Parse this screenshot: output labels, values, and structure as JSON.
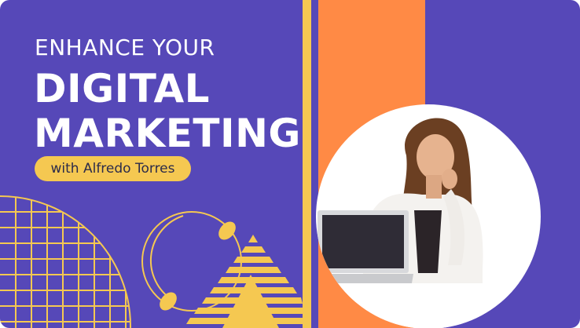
{
  "banner": {
    "headline_line1": "ENHANCE YOUR",
    "headline_line2": "DIGITAL",
    "headline_line3": "MARKETING",
    "presenter": "with Alfredo Torres"
  },
  "colors": {
    "background": "#5648b8",
    "accent_yellow": "#f5c851",
    "accent_orange": "#ff8a45",
    "text": "#ffffff",
    "pill_text": "#2c2b4a"
  },
  "photo": {
    "subject": "woman-with-laptop-photo"
  }
}
